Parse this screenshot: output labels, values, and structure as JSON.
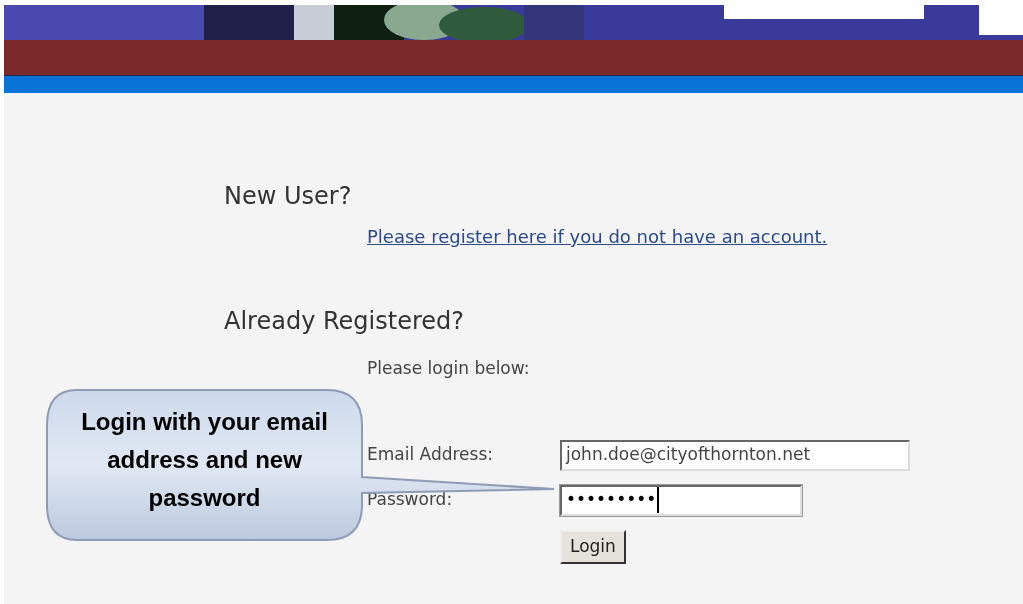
{
  "new_user": {
    "heading": "New User?",
    "link": "Please register here if you do not have an account."
  },
  "login": {
    "heading": "Already Registered?",
    "instruction": "Please login below:",
    "fields": [
      {
        "label": "Email Address:",
        "value": "john.doe@cityofthornton.net",
        "focused": false
      },
      {
        "label": "Password:",
        "value": "•••••••••",
        "focused": true
      }
    ],
    "button": "Login"
  },
  "callout": {
    "text": "Login with your email address and new password"
  }
}
